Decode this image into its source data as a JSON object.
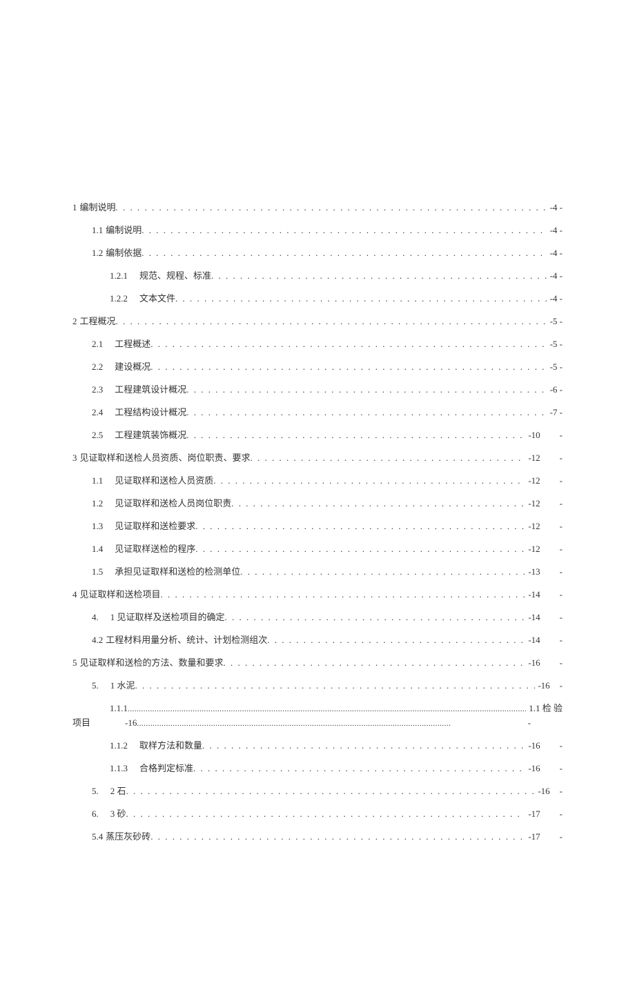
{
  "toc": [
    {
      "indent": 0,
      "num": "1",
      "title": "编制说明",
      "dots": "long",
      "page": "-4 -",
      "dash": ""
    },
    {
      "indent": 1,
      "num": "1.1",
      "title": "编制说明",
      "dots": "long",
      "page": "-4 -",
      "dash": ""
    },
    {
      "indent": 1,
      "num": "1.2",
      "title": "编制依据",
      "dots": "long",
      "page": "-4 -",
      "dash": ""
    },
    {
      "indent": 2,
      "num": "1.2.1",
      "gap": "　",
      "title": "规范、规程、标准",
      "dots": "long",
      "page": "-4 -",
      "dash": ""
    },
    {
      "indent": 2,
      "num": "1.2.2",
      "gap": "　",
      "title": "文本文件",
      "dots": "long",
      "page": "-4 -",
      "dash": ""
    },
    {
      "indent": 0,
      "num": "2",
      "title": "工程概况",
      "dots": "long",
      "page": "-5 -",
      "dash": ""
    },
    {
      "indent": 1,
      "num": "2.1",
      "gap": "　",
      "title": "工程概述",
      "dots": "long",
      "page": "-5 -",
      "dash": ""
    },
    {
      "indent": 1,
      "num": "2.2",
      "gap": "　",
      "title": "建设概况",
      "dots": "long",
      "page": "-5 -",
      "dash": ""
    },
    {
      "indent": 1,
      "num": "2.3",
      "gap": "　",
      "title": "工程建筑设计概况",
      "dots": "long",
      "page": "-6 -",
      "dash": ""
    },
    {
      "indent": 1,
      "num": "2.4",
      "gap": "　",
      "title": "工程结构设计概况",
      "dots": "long",
      "page": "-7 -",
      "dash": ""
    },
    {
      "indent": 1,
      "num": "2.5",
      "gap": "　",
      "title": "工程建筑装饰概况",
      "dots": "med",
      "page": "-10",
      "dash": "-"
    },
    {
      "indent": 0,
      "num": "3",
      "title": "见证取样和送检人员资质、岗位职责、要求",
      "dots": "short",
      "page": "-12",
      "dash": "-"
    },
    {
      "indent": 1,
      "num": "1.1",
      "gap": "　",
      "title": "见证取样和送检人员资质",
      "dots": "med",
      "page": "-12",
      "dash": "-"
    },
    {
      "indent": 1,
      "num": "1.2",
      "gap": "　",
      "title": "见证取样和送检人员岗位职责",
      "dots": "med",
      "page": "-12",
      "dash": "-"
    },
    {
      "indent": 1,
      "num": "1.3",
      "gap": "　",
      "title": "见证取样和送检要求",
      "dots": "med",
      "page": "-12",
      "dash": "-"
    },
    {
      "indent": 1,
      "num": "1.4",
      "gap": "　",
      "title": "见证取样送检的程序",
      "dots": "med",
      "page": "-12",
      "dash": "-"
    },
    {
      "indent": 1,
      "num": "1.5",
      "gap": "　",
      "title": "承担见证取样和送检的检测单位",
      "dots": "short",
      "page": "-13",
      "dash": "-"
    },
    {
      "indent": 0,
      "num": "4",
      "title": "见证取样和送检项目",
      "dots": "med",
      "page": "-14",
      "dash": "-"
    },
    {
      "indent": 1,
      "num": "4.",
      "gap": "　",
      "title": "1 见证取样及送检项目的确定",
      "dots": "med",
      "page": "-14",
      "dash": "-"
    },
    {
      "indent": 1,
      "num": "4.2",
      "title": "工程材料用量分析、统计、计划检测组次",
      "dots": "short",
      "page": "-14",
      "dash": "-"
    },
    {
      "indent": 0,
      "num": "5",
      "title": "见证取样和送检的方法、数量和要求",
      "dots": "med",
      "page": "-16",
      "dash": "-"
    },
    {
      "indent": 1,
      "num": "5.",
      "gap": "　",
      "title": "1 水泥",
      "dots": "long",
      "page": "-16",
      "dash": "-",
      "tiny_dash": true
    }
  ],
  "special_item": {
    "l1_num": "1.1.1",
    "l1_page_right": "1.1 检 验",
    "l2_left": "项目",
    "l2_mid": "-16",
    "l2_trail": "-"
  },
  "toc2": [
    {
      "indent": 2,
      "num": "1.1.2",
      "gap": "　",
      "title": "取样方法和数量",
      "dots": "med",
      "page": "-16",
      "dash": "-"
    },
    {
      "indent": 2,
      "num": "1.1.3",
      "gap": "　",
      "title": "合格判定标准",
      "dots": "med",
      "page": "-16",
      "dash": "-"
    },
    {
      "indent": 1,
      "num": "5.",
      "gap": "　",
      "title": "2 石",
      "dots": "long",
      "page": "-16",
      "dash": "-",
      "tiny_dash": true
    },
    {
      "indent": 1,
      "num": "6.",
      "gap": "　",
      "title": "3 砂",
      "dots": "long",
      "page": "-17",
      "dash": "-"
    },
    {
      "indent": 1,
      "num": "5.4",
      "title": "蒸压灰砂砖",
      "dots": "long",
      "page": "-17",
      "dash": "-"
    }
  ],
  "dots_seq": ". . . . . . . . . . . . . . . . . . . . . . . . . . . . . . . . . . . . . . . . . . . . . . . . . . . . . . . . . . . . . . . . . . . . . . . . . . . . . . . . . . . . . . . . . . . . . . . . . . . ."
}
